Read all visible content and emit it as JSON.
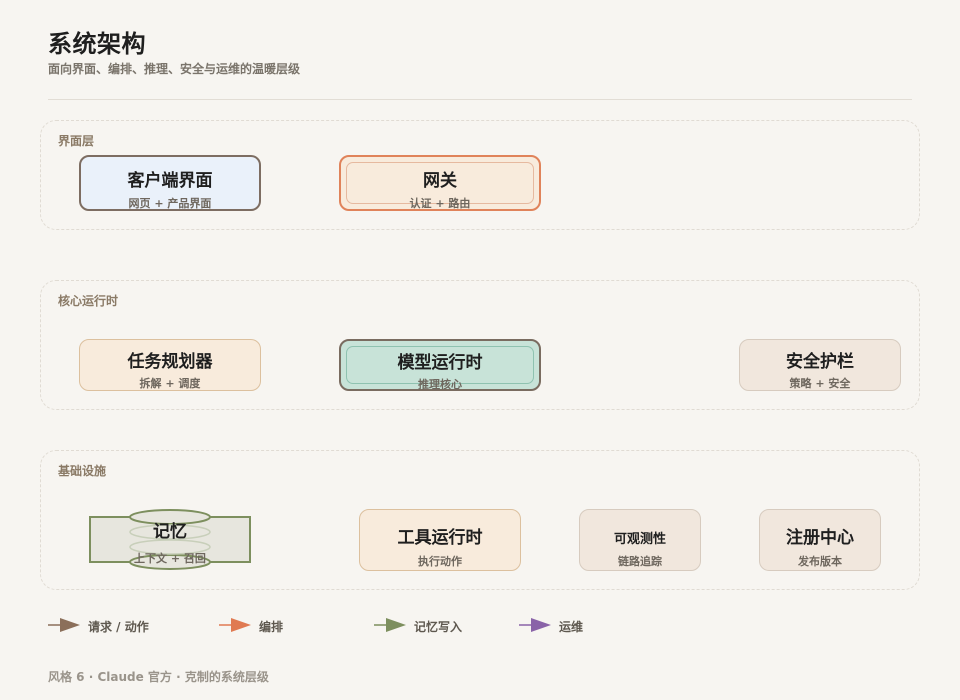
{
  "header": {
    "title": "系统架构",
    "subtitle": "面向界面、编排、推理、安全与运维的温暖层级"
  },
  "layers": {
    "interface": {
      "label": "界面层",
      "client": {
        "name": "客户端界面",
        "sub": "网页 + 产品界面"
      },
      "gateway": {
        "name": "网关",
        "sub": "认证 + 路由"
      }
    },
    "core": {
      "label": "核心运行时",
      "planner": {
        "name": "任务规划器",
        "sub": "拆解 + 调度"
      },
      "model": {
        "name": "模型运行时",
        "sub": "推理核心"
      },
      "guardrail": {
        "name": "安全护栏",
        "sub": "策略 + 安全"
      }
    },
    "infra": {
      "label": "基础设施",
      "memory": {
        "name": "记忆",
        "sub": "上下文 + 召回"
      },
      "tools": {
        "name": "工具运行时",
        "sub": "执行动作"
      },
      "observability": {
        "name": "可观测性",
        "sub": "链路追踪"
      },
      "registry": {
        "name": "注册中心",
        "sub": "发布版本"
      }
    }
  },
  "legend": [
    {
      "label": "请求 / 动作",
      "color": "#8b6f5a"
    },
    {
      "label": "编排",
      "color": "#e07a52"
    },
    {
      "label": "记忆写入",
      "color": "#7d8f5e"
    },
    {
      "label": "运维",
      "color": "#8a63a8"
    }
  ],
  "footer": "风格 6 · Claude 官方 · 克制的系统层级"
}
